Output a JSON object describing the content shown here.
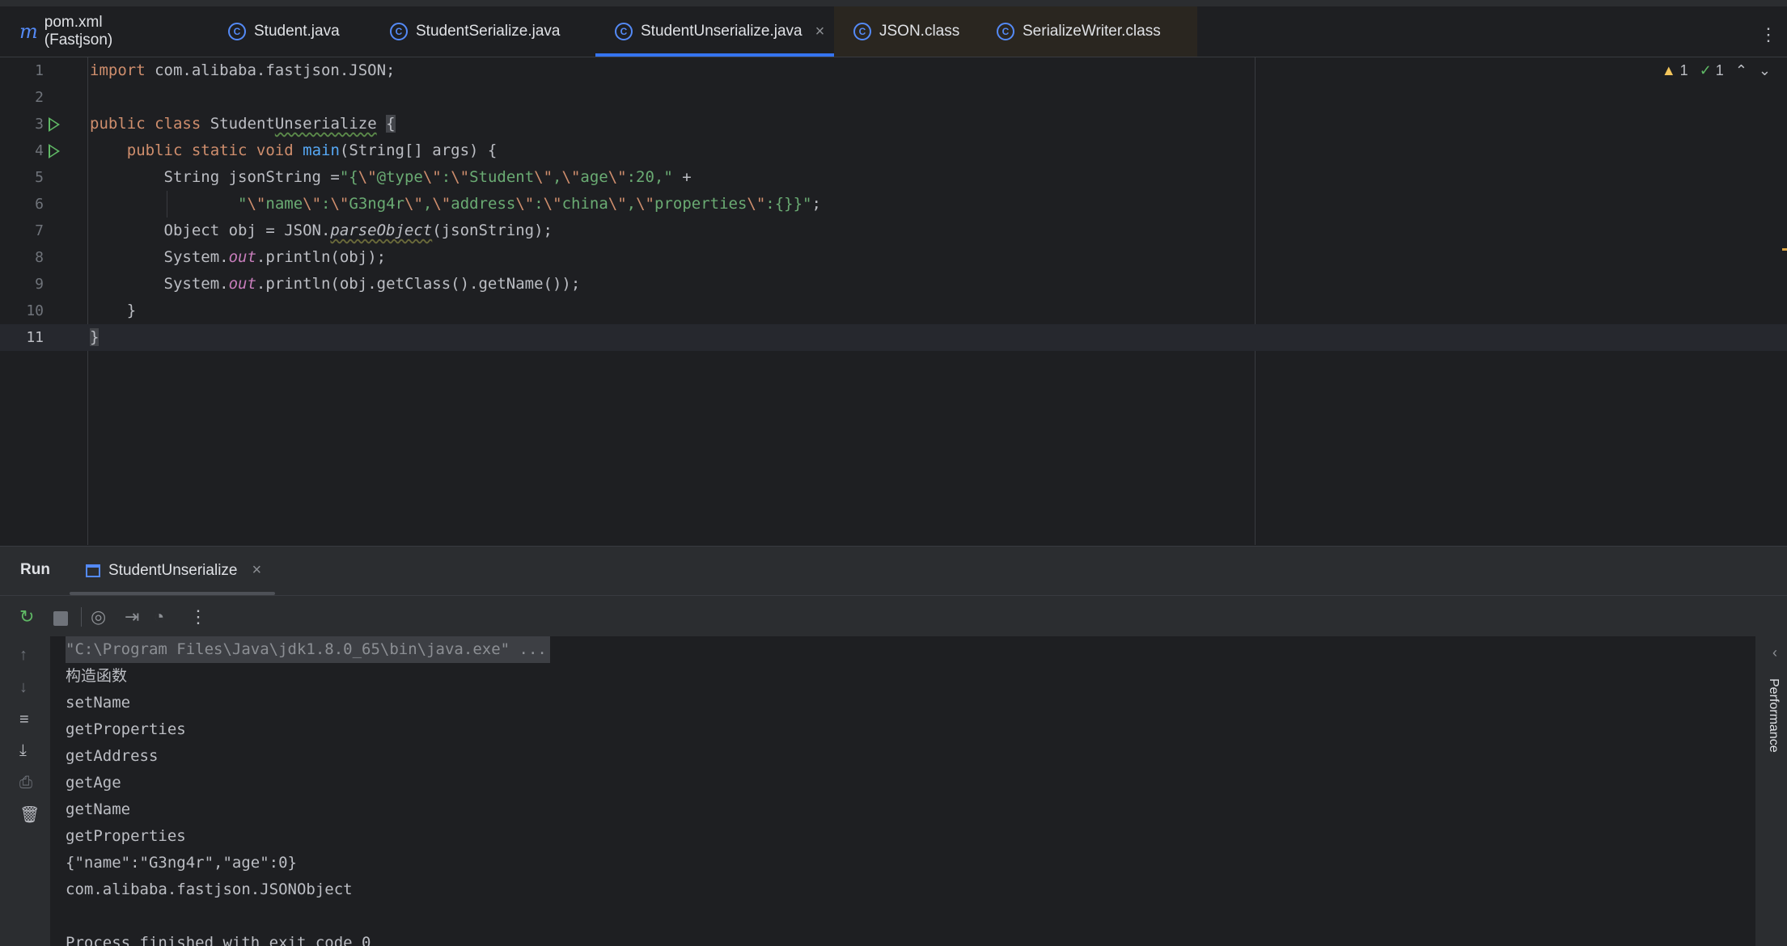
{
  "tabs": [
    {
      "label": "pom.xml (Fastjson)",
      "icon": "maven-icon"
    },
    {
      "label": "Student.java",
      "icon": "class-icon"
    },
    {
      "label": "StudentSerialize.java",
      "icon": "runnable-class-icon"
    },
    {
      "label": "StudentUnserialize.java",
      "icon": "runnable-class-icon",
      "active": true
    },
    {
      "label": "JSON.class",
      "icon": "class-icon"
    },
    {
      "label": "SerializeWriter.class",
      "icon": "class-icon"
    }
  ],
  "inspections": {
    "warnings": "1",
    "weak_warnings": "1"
  },
  "editor": {
    "line_numbers": [
      "1",
      "2",
      "3",
      "4",
      "5",
      "6",
      "7",
      "8",
      "9",
      "10",
      "11"
    ],
    "l1": {
      "kw": "import",
      "rest": " com.alibaba.fastjson.JSON;"
    },
    "l3": {
      "kw1": "public",
      "kw2": "class",
      "name_a": "Student",
      "name_b": "Unserialize",
      "brace": "{"
    },
    "l4": {
      "kw": "public static void",
      "fn": "main",
      "rest": "(String[] args) {"
    },
    "l5": {
      "a": "String jsonString =",
      "s1": "\"{",
      "e1": "\\\"",
      "s2": "@type",
      "e2": "\\\"",
      "s3": ":",
      "e3": "\\\"",
      "s4": "Student",
      "e4": "\\\"",
      "s5": ",",
      "e5": "\\\"",
      "s6": "age",
      "e6": "\\\"",
      "s7": ":20,\"",
      "b": " +"
    },
    "l6": {
      "s1": "\"",
      "e1": "\\\"",
      "s2": "name",
      "e2": "\\\"",
      "s3": ":",
      "e3": "\\\"",
      "s4": "G3ng4r",
      "e4": "\\\"",
      "s5": ",",
      "e5": "\\\"",
      "s6": "address",
      "e6": "\\\"",
      "s7": ":",
      "e7": "\\\"",
      "s8": "china",
      "e8": "\\\"",
      "s9": ",",
      "e9": "\\\"",
      "s10": "properties",
      "e10": "\\\"",
      "s11": ":{}}\"",
      "b": ";"
    },
    "l7": {
      "a": "Object obj = JSON.",
      "m": "parseObject",
      "b": "(jsonString);"
    },
    "l8": {
      "a": "System.",
      "out": "out",
      "b": ".println(obj);"
    },
    "l9": {
      "a": "System.",
      "out": "out",
      "b": ".println(obj.getClass().getName());"
    },
    "l10": "}",
    "l11": "}"
  },
  "run": {
    "title": "Run",
    "tab_label": "StudentUnserialize",
    "side_label": "Performance",
    "console_lines": [
      "\"C:\\Program Files\\Java\\jdk1.8.0_65\\bin\\java.exe\" ...",
      "构造函数",
      "setName",
      "getProperties",
      "getAddress",
      "getAge",
      "getName",
      "getProperties",
      "{\"name\":\"G3ng4r\",\"age\":0}",
      "com.alibaba.fastjson.JSONObject",
      "",
      "Process finished with exit code 0"
    ]
  }
}
